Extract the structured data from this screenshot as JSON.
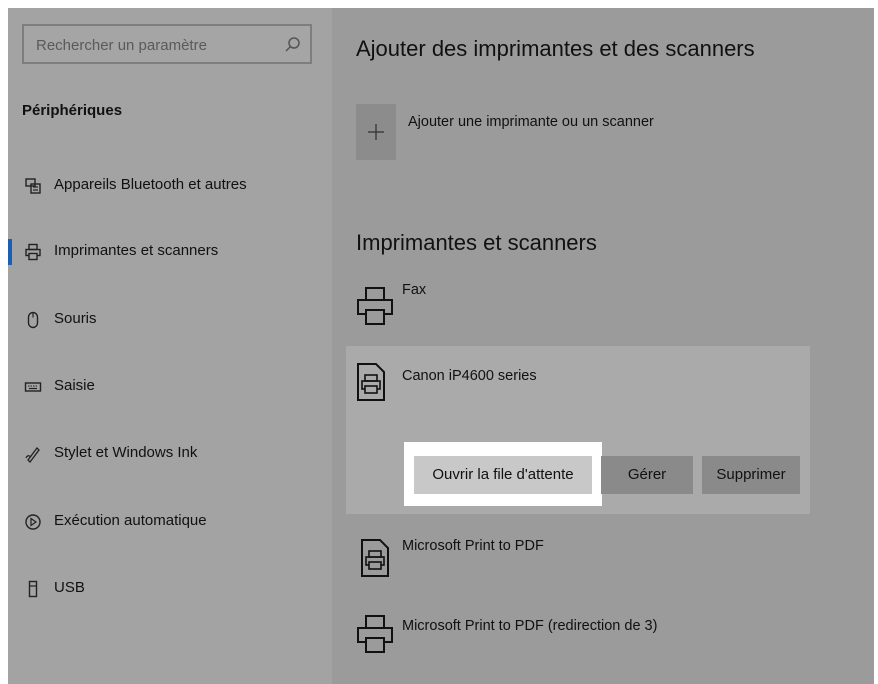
{
  "search": {
    "placeholder": "Rechercher un paramètre"
  },
  "sidebar": {
    "heading": "Périphériques",
    "items": [
      {
        "label": "Appareils Bluetooth et autres",
        "icon": "bluetooth-devices-icon"
      },
      {
        "label": "Imprimantes et scanners",
        "icon": "printer-icon",
        "selected": true
      },
      {
        "label": "Souris",
        "icon": "mouse-icon"
      },
      {
        "label": "Saisie",
        "icon": "keyboard-icon"
      },
      {
        "label": "Stylet et Windows Ink",
        "icon": "pen-icon"
      },
      {
        "label": "Exécution automatique",
        "icon": "autoplay-icon"
      },
      {
        "label": "USB",
        "icon": "usb-icon"
      }
    ]
  },
  "main": {
    "add_section_title": "Ajouter des imprimantes et des scanners",
    "add_button_label": "Ajouter une imprimante ou un scanner",
    "list_section_title": "Imprimantes et scanners",
    "printers": [
      {
        "name": "Fax",
        "icon": "printer-icon"
      },
      {
        "name": "Canon iP4600 series",
        "icon": "document-printer-icon",
        "selected": true
      },
      {
        "name": "Microsoft Print to PDF",
        "icon": "document-printer-icon"
      },
      {
        "name": "Microsoft Print to PDF (redirection de 3)",
        "icon": "printer-icon"
      }
    ],
    "actions": {
      "open_queue": "Ouvrir la file d'attente",
      "manage": "Gérer",
      "remove": "Supprimer"
    }
  },
  "colors": {
    "accent": "#1a5fb4",
    "highlight": "#ffffff"
  }
}
